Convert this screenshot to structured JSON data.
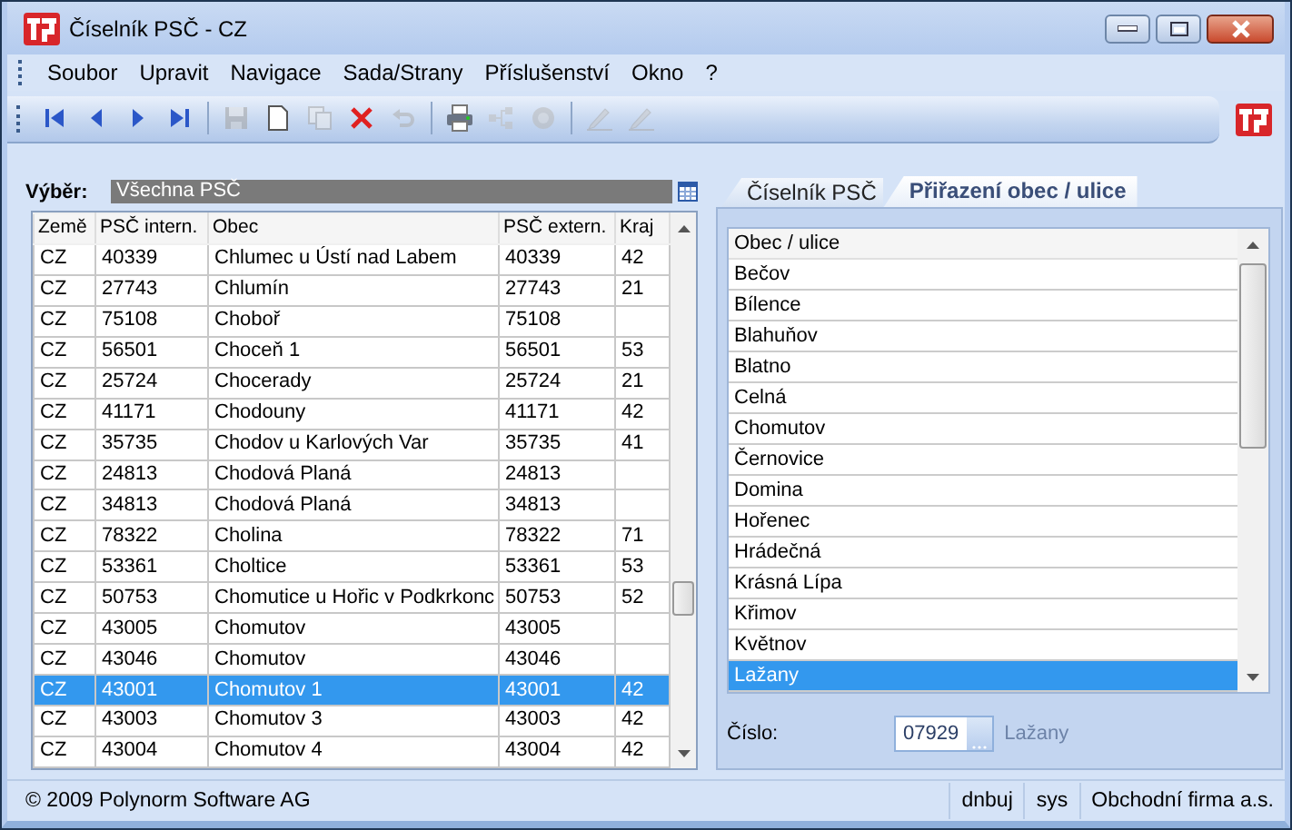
{
  "window": {
    "title": "Číselník PSČ - CZ"
  },
  "menu": [
    "Soubor",
    "Upravit",
    "Navigace",
    "Sada/Strany",
    "Příslušenství",
    "Okno",
    "?"
  ],
  "toolbar": [
    {
      "kind": "first",
      "disabled": false
    },
    {
      "kind": "prev",
      "disabled": false
    },
    {
      "kind": "next",
      "disabled": false
    },
    {
      "kind": "last",
      "disabled": false
    },
    {
      "kind": "sep"
    },
    {
      "kind": "save",
      "disabled": true
    },
    {
      "kind": "new",
      "disabled": false
    },
    {
      "kind": "copy",
      "disabled": true
    },
    {
      "kind": "delete",
      "disabled": false
    },
    {
      "kind": "undo",
      "disabled": true
    },
    {
      "kind": "sep"
    },
    {
      "kind": "print",
      "disabled": false
    },
    {
      "kind": "tree",
      "disabled": true
    },
    {
      "kind": "record",
      "disabled": true
    },
    {
      "kind": "sep"
    },
    {
      "kind": "edit",
      "disabled": true
    },
    {
      "kind": "edit",
      "disabled": true
    }
  ],
  "filter": {
    "label": "Výběr:",
    "value": "Všechna PSČ"
  },
  "table": {
    "columns": [
      "Země",
      "PSČ intern.",
      "Obec",
      "PSČ extern.",
      "Kraj"
    ],
    "rows": [
      {
        "cells": [
          "CZ",
          "40339",
          "Chlumec u Ústí nad Labem",
          "40339",
          "42"
        ],
        "selected": false
      },
      {
        "cells": [
          "CZ",
          "27743",
          "Chlumín",
          "27743",
          "21"
        ],
        "selected": false
      },
      {
        "cells": [
          "CZ",
          "75108",
          "Choboř",
          "75108",
          ""
        ],
        "selected": false
      },
      {
        "cells": [
          "CZ",
          "56501",
          "Choceň 1",
          "56501",
          "53"
        ],
        "selected": false
      },
      {
        "cells": [
          "CZ",
          "25724",
          "Chocerady",
          "25724",
          "21"
        ],
        "selected": false
      },
      {
        "cells": [
          "CZ",
          "41171",
          "Chodouny",
          "41171",
          "42"
        ],
        "selected": false
      },
      {
        "cells": [
          "CZ",
          "35735",
          "Chodov u Karlových Var",
          "35735",
          "41"
        ],
        "selected": false
      },
      {
        "cells": [
          "CZ",
          "24813",
          "Chodová Planá",
          "24813",
          ""
        ],
        "selected": false
      },
      {
        "cells": [
          "CZ",
          "34813",
          "Chodová Planá",
          "34813",
          ""
        ],
        "selected": false
      },
      {
        "cells": [
          "CZ",
          "78322",
          "Cholina",
          "78322",
          "71"
        ],
        "selected": false
      },
      {
        "cells": [
          "CZ",
          "53361",
          "Choltice",
          "53361",
          "53"
        ],
        "selected": false
      },
      {
        "cells": [
          "CZ",
          "50753",
          "Chomutice u Hořic v Podkrkonc",
          "50753",
          "52"
        ],
        "selected": false
      },
      {
        "cells": [
          "CZ",
          "43005",
          "Chomutov",
          "43005",
          ""
        ],
        "selected": false
      },
      {
        "cells": [
          "CZ",
          "43046",
          "Chomutov",
          "43046",
          ""
        ],
        "selected": false
      },
      {
        "cells": [
          "CZ",
          "43001",
          "Chomutov 1",
          "43001",
          "42"
        ],
        "selected": true
      },
      {
        "cells": [
          "CZ",
          "43003",
          "Chomutov 3",
          "43003",
          "42"
        ],
        "selected": false
      },
      {
        "cells": [
          "CZ",
          "43004",
          "Chomutov 4",
          "43004",
          "42"
        ],
        "selected": false
      }
    ]
  },
  "tabs": [
    {
      "label": "Číselník PSČ",
      "selected": false
    },
    {
      "label": "Přiřazení obec / ulice",
      "selected": true
    }
  ],
  "list": {
    "header": "Obec / ulice",
    "items": [
      {
        "label": "Bečov",
        "selected": false
      },
      {
        "label": "Bílence",
        "selected": false
      },
      {
        "label": "Blahuňov",
        "selected": false
      },
      {
        "label": "Blatno",
        "selected": false
      },
      {
        "label": "Celná",
        "selected": false
      },
      {
        "label": "Chomutov",
        "selected": false
      },
      {
        "label": "Černovice",
        "selected": false
      },
      {
        "label": "Domina",
        "selected": false
      },
      {
        "label": "Hořenec",
        "selected": false
      },
      {
        "label": "Hrádečná",
        "selected": false
      },
      {
        "label": "Krásná Lípa",
        "selected": false
      },
      {
        "label": "Křimov",
        "selected": false
      },
      {
        "label": "Květnov",
        "selected": false
      },
      {
        "label": "Lažany",
        "selected": true
      }
    ]
  },
  "number": {
    "label": "Číslo:",
    "value": "07929",
    "name": "Lažany"
  },
  "status_bar": {
    "copyright": "© 2009 Polynorm Software AG",
    "user": "dnbuj",
    "database": "sys",
    "company": "Obchodní firma a.s."
  }
}
